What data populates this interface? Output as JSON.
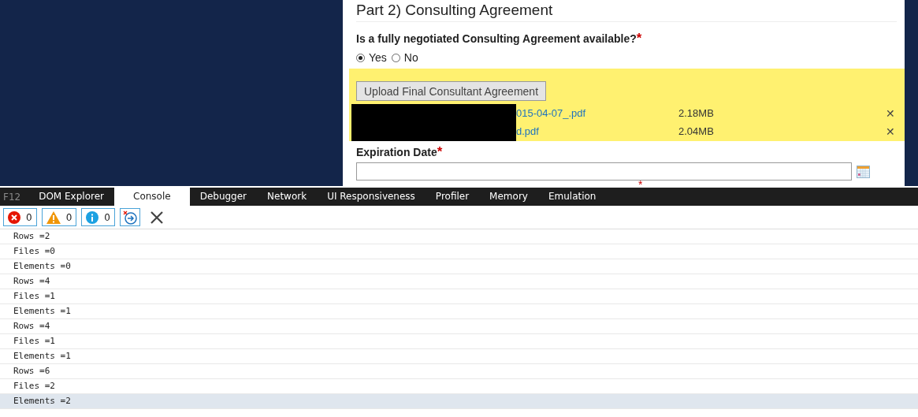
{
  "form": {
    "section_title": "Part 2) Consulting Agreement",
    "question": {
      "label": "Is a fully negotiated Consulting Agreement available?",
      "required_mark": "*",
      "options": [
        {
          "label": "Yes",
          "selected": true
        },
        {
          "label": "No",
          "selected": false
        }
      ]
    },
    "upload": {
      "button": "Upload Final Consultant Agreement",
      "redacted": true,
      "files": [
        {
          "name": "015-04-07_.pdf",
          "size": "2.18MB",
          "remove": "✕"
        },
        {
          "name": "d.pdf",
          "size": "2.04MB",
          "remove": "✕"
        }
      ]
    },
    "expiration": {
      "label": "Expiration Date",
      "required_mark": "*"
    },
    "next_required_mark": "*"
  },
  "devtools": {
    "f12": "F12",
    "tabs": [
      {
        "label": "DOM Explorer",
        "selected": false
      },
      {
        "label": "Console",
        "selected": true
      },
      {
        "label": "Debugger",
        "selected": false
      },
      {
        "label": "Network",
        "selected": false
      },
      {
        "label": "UI Responsiveness",
        "selected": false
      },
      {
        "label": "Profiler",
        "selected": false
      },
      {
        "label": "Memory",
        "selected": false
      },
      {
        "label": "Emulation",
        "selected": false
      }
    ],
    "counters": [
      {
        "kind": "error",
        "count": "0"
      },
      {
        "kind": "warning",
        "count": "0"
      },
      {
        "kind": "info",
        "count": "0"
      }
    ],
    "log": [
      {
        "text": "Rows =2",
        "selected": false
      },
      {
        "text": "Files =0",
        "selected": false
      },
      {
        "text": "Elements =0",
        "selected": false
      },
      {
        "text": "Rows =4",
        "selected": false
      },
      {
        "text": "Files =1",
        "selected": false
      },
      {
        "text": "Elements =1",
        "selected": false
      },
      {
        "text": "Rows =4",
        "selected": false
      },
      {
        "text": "Files =1",
        "selected": false
      },
      {
        "text": "Elements =1",
        "selected": false
      },
      {
        "text": "Rows =6",
        "selected": false
      },
      {
        "text": "Files =2",
        "selected": false
      },
      {
        "text": "Elements =2",
        "selected": true
      }
    ]
  }
}
